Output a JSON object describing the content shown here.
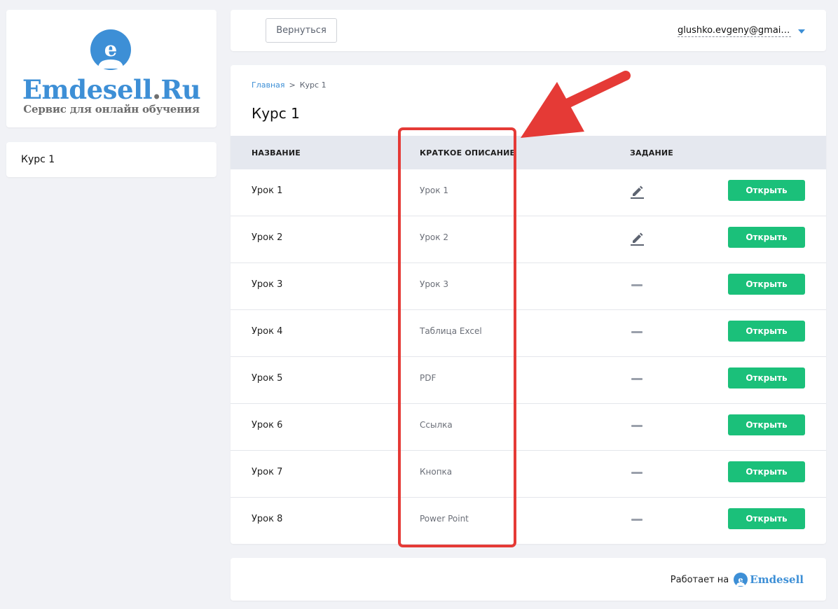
{
  "logo": {
    "title_main": "Emdesell",
    "title_dot": ".",
    "title_tld": "Ru",
    "subtitle": "Сервис для онлайн обучения",
    "icon": "user-e-icon",
    "color": "#3d8fd6"
  },
  "sidebar": {
    "items": [
      {
        "label": "Курс 1"
      }
    ]
  },
  "topbar": {
    "back_label": "Вернуться",
    "user_email": "glushko.evgeny@gmai…"
  },
  "breadcrumb": {
    "home": "Главная",
    "separator": ">",
    "current": "Курс 1"
  },
  "page_title": "Курс 1",
  "table": {
    "headers": {
      "name": "НАЗВАНИЕ",
      "desc": "КРАТКОЕ ОПИСАНИЕ",
      "task": "ЗАДАНИЕ"
    },
    "rows": [
      {
        "name": "Урок 1",
        "desc": "Урок 1",
        "task": "pencil-icon",
        "action": "Открыть"
      },
      {
        "name": "Урок 2",
        "desc": "Урок 2",
        "task": "pencil-icon",
        "action": "Открыть"
      },
      {
        "name": "Урок 3",
        "desc": "Урок 3",
        "task": "dash-icon",
        "action": "Открыть"
      },
      {
        "name": "Урок 4",
        "desc": "Таблица Excel",
        "task": "dash-icon",
        "action": "Открыть"
      },
      {
        "name": "Урок 5",
        "desc": "PDF",
        "task": "dash-icon",
        "action": "Открыть"
      },
      {
        "name": "Урок 6",
        "desc": "Ссылка",
        "task": "dash-icon",
        "action": "Открыть"
      },
      {
        "name": "Урок 7",
        "desc": "Кнопка",
        "task": "dash-icon",
        "action": "Открыть"
      },
      {
        "name": "Урок 8",
        "desc": "Power Point",
        "task": "dash-icon",
        "action": "Открыть"
      }
    ]
  },
  "footer": {
    "powered_by": "Работает на",
    "brand": "Emdesell"
  },
  "colors": {
    "accent": "#3d8fd6",
    "button_green": "#1bc07a",
    "annotation_red": "#e53a36",
    "header_bg": "#e5e8ef"
  }
}
